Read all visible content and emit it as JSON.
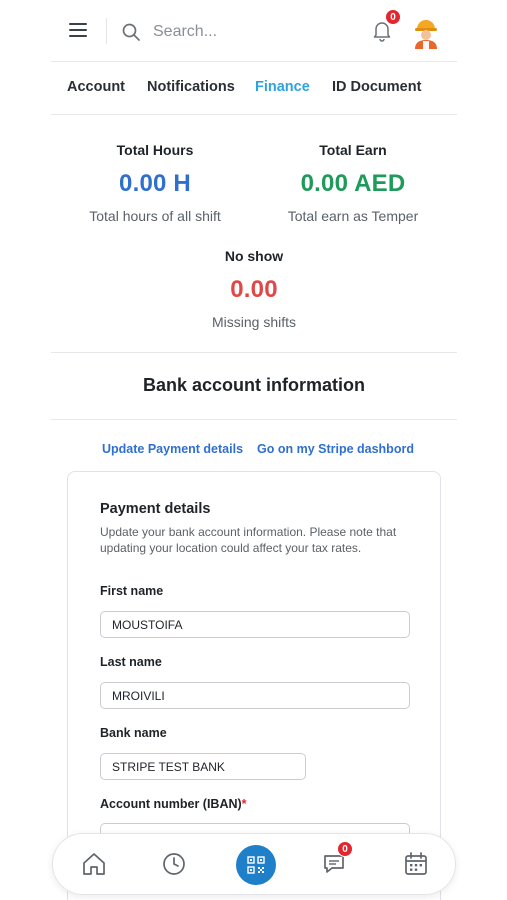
{
  "header": {
    "search_placeholder": "Search...",
    "notification_count": "0"
  },
  "tabs": [
    {
      "label": "Account",
      "active": false
    },
    {
      "label": "Notifications",
      "active": false
    },
    {
      "label": "Finance",
      "active": true
    },
    {
      "label": "ID Document",
      "active": false
    }
  ],
  "stats": {
    "total_hours": {
      "label": "Total Hours",
      "value": "0.00 H",
      "sub": "Total hours of all shift",
      "color": "#2f6fcf"
    },
    "total_earn": {
      "label": "Total Earn",
      "value": "0.00 AED",
      "sub": "Total earn as Temper",
      "color": "#1e9a5a"
    },
    "no_show": {
      "label": "No show",
      "value": "0.00",
      "sub": "Missing shifts",
      "color": "#e04848"
    }
  },
  "bank": {
    "title": "Bank account information",
    "update_link": "Update Payment details",
    "stripe_link": "Go on my Stripe dashbord"
  },
  "payment": {
    "title": "Payment details",
    "description": "Update your bank account information. Please note that updating your location could affect your tax rates.",
    "first_name_label": "First name",
    "first_name_value": "MOUSTOIFA",
    "last_name_label": "Last name",
    "last_name_value": "MROIVILI",
    "bank_name_label": "Bank name",
    "bank_name_value": "STRIPE TEST BANK",
    "account_label": "Account number (IBAN)",
    "account_required": "*"
  },
  "bottom_nav": {
    "chat_count": "0",
    "icons": [
      "home-icon",
      "clock-icon",
      "qr-code-icon",
      "chat-icon",
      "calendar-icon"
    ]
  },
  "colors": {
    "accent_tab": "#2ea3e0",
    "link": "#2f6fcf",
    "badge": "#e3262d",
    "nav_center": "#1f7fc9"
  }
}
